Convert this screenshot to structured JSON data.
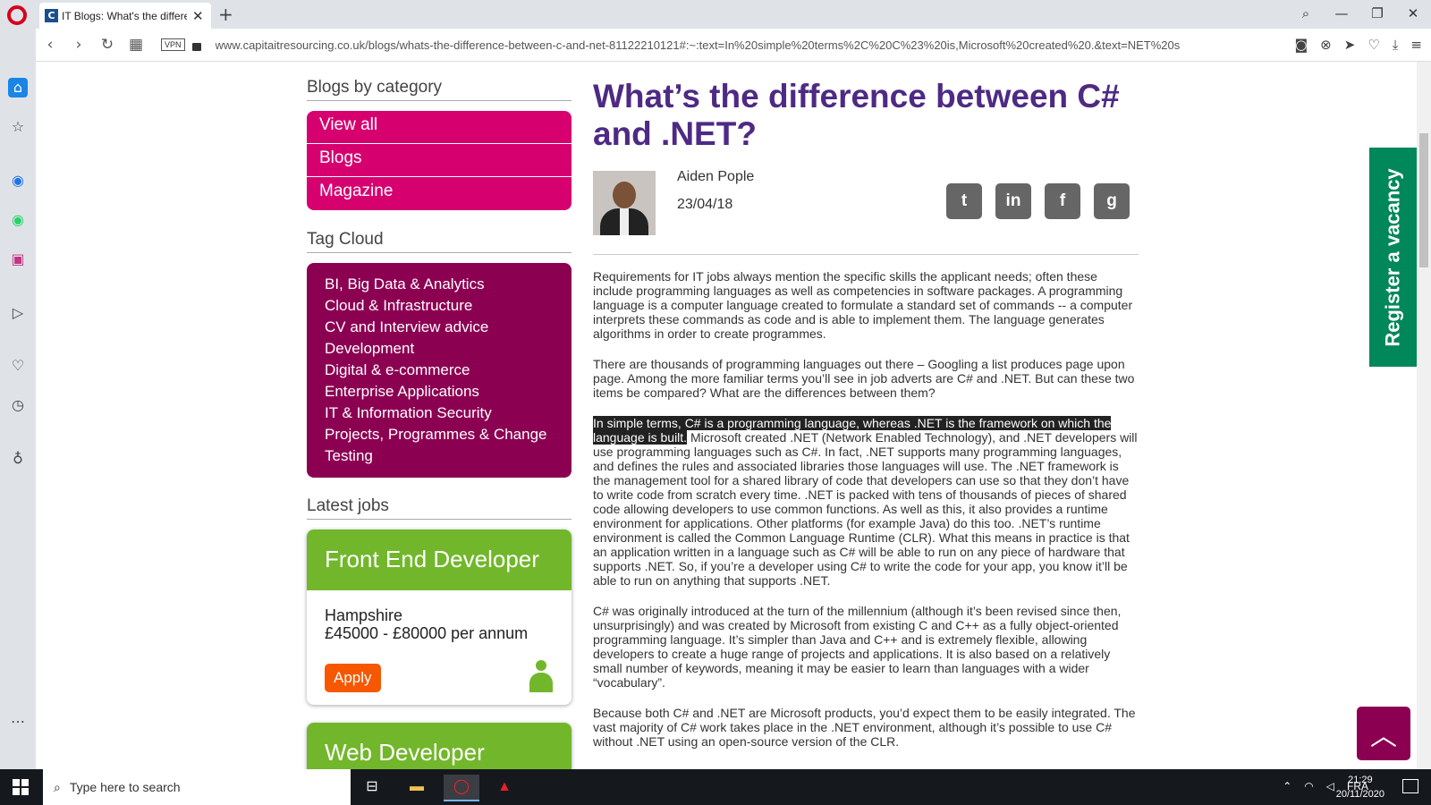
{
  "browser": {
    "tab_title": "IT Blogs: What's the difference",
    "url": "www.capitaitresourcing.co.uk/blogs/whats-the-difference-between-c-and-net-81122210121#:~:text=In%20simple%20terms%2C%20C%23%20is,Microsoft%20created%20.&text=NET%20s",
    "vpn_label": "VPN"
  },
  "sidebar": {
    "blogs_by_category": "Blogs by category",
    "categories": [
      "View all",
      "Blogs",
      "Magazine"
    ],
    "tag_cloud_title": "Tag Cloud",
    "tags": [
      "BI, Big Data & Analytics",
      "Cloud & Infrastructure",
      "CV and Interview advice",
      "Development",
      "Digital & e-commerce",
      "Enterprise Applications",
      "IT & Information Security",
      "Projects, Programmes & Change",
      "Testing"
    ],
    "latest_jobs_title": "Latest jobs",
    "jobs": [
      {
        "title": "Front End Developer",
        "location": "Hampshire",
        "salary": "£45000 - £80000 per annum",
        "apply": "Apply"
      },
      {
        "title": "Web Developer"
      }
    ]
  },
  "article": {
    "title": "What’s the difference between C# and .NET?",
    "author": "Aiden Pople",
    "date": "23/04/18",
    "social": [
      "t",
      "in",
      "f",
      "g"
    ],
    "p1": "Requirements for IT jobs always mention the specific skills the applicant needs; often these include programming languages as well as competencies in software packages. A programming language is a computer language created to formulate a standard set of commands -- a computer interprets these commands as code and is able to implement them. The language generates algorithms in order to create programmes.",
    "p2": "There are thousands of programming languages out there – Googling a list produces page upon page. Among the more familiar terms you’ll see in job adverts are C# and .NET. But can these two items be compared? What are the differences between them?",
    "p3_highlight": "In simple terms, C# is a programming language, whereas .NET is the framework on which the language is built.",
    "p3_rest": " Microsoft created .NET (Network Enabled Technology), and .NET developers will use programming languages such as C#. In fact, .NET supports many programming languages, and defines the rules and associated libraries those languages will use. The .NET framework is the management tool for a shared library of code that developers can use so that they don’t have to write code from scratch every time. .NET is packed with tens of thousands of pieces of shared code allowing developers to use common functions. As well as this, it also provides a runtime environment for applications. Other platforms (for example Java) do this too. .NET’s runtime environment is called the Common Language Runtime (CLR). What this means in practice is that an application written in a language such as C# will be able to run on any piece of hardware that supports .NET. So, if you’re a developer using C# to write the code for your app, you know it’ll be able to run on anything that supports .NET.",
    "p4": "C# was originally introduced at the turn of the millennium (although it’s been revised since then, unsurprisingly) and was created by Microsoft from existing C and C++ as a fully object-oriented programming language. It’s simpler than Java and C++ and is extremely flexible, allowing developers to create a huge range of projects and applications. It is also based on a relatively small number of keywords, meaning it may be easier to learn than languages with a wider “vocabulary”.",
    "p5": "Because both C# and .NET are Microsoft products, you’d expect them to be easily integrated. The vast majority of C# work takes place in the .NET environment, although it’s possible to use C# without .NET using an open-source version of the CLR."
  },
  "register_tab": "Register a vacancy",
  "taskbar": {
    "search_placeholder": "Type here to search",
    "lang": "FRA",
    "time": "21:29",
    "date": "20/11/2020"
  },
  "colors": {
    "accent_purple": "#4e2a84",
    "category_pink": "#d6006f",
    "tag_purple": "#8c0052",
    "job_green": "#72b72b",
    "apply_orange": "#f55800",
    "register_green": "#00875a"
  }
}
